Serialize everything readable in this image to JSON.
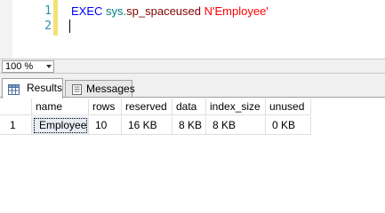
{
  "editor": {
    "line_numbers": [
      "1",
      "2"
    ],
    "query": {
      "exec": "EXEC",
      "schema": "sys.",
      "proc": "sp_spaceused",
      "arg": "N'Employee'"
    }
  },
  "zoom": {
    "value": "100 %"
  },
  "tabs": {
    "results": "Results",
    "messages": "Messages"
  },
  "grid": {
    "columns": [
      "name",
      "rows",
      "reserved",
      "data",
      "index_size",
      "unused"
    ],
    "rows": [
      {
        "row_number": "1",
        "cells": [
          "Employee",
          "10",
          "16 KB",
          "8 KB",
          "8 KB",
          "0 KB"
        ]
      }
    ]
  },
  "colors": {
    "keyword": "#0000ff",
    "system_object": "#008080",
    "procedure": "#800000",
    "string": "#ff0000",
    "line_number": "#2b91af",
    "change_bar": "#f3e275"
  },
  "icons": {
    "results_tab": "grid-icon",
    "messages_tab": "messages-icon",
    "zoom_dropdown": "chevron-down-icon"
  }
}
